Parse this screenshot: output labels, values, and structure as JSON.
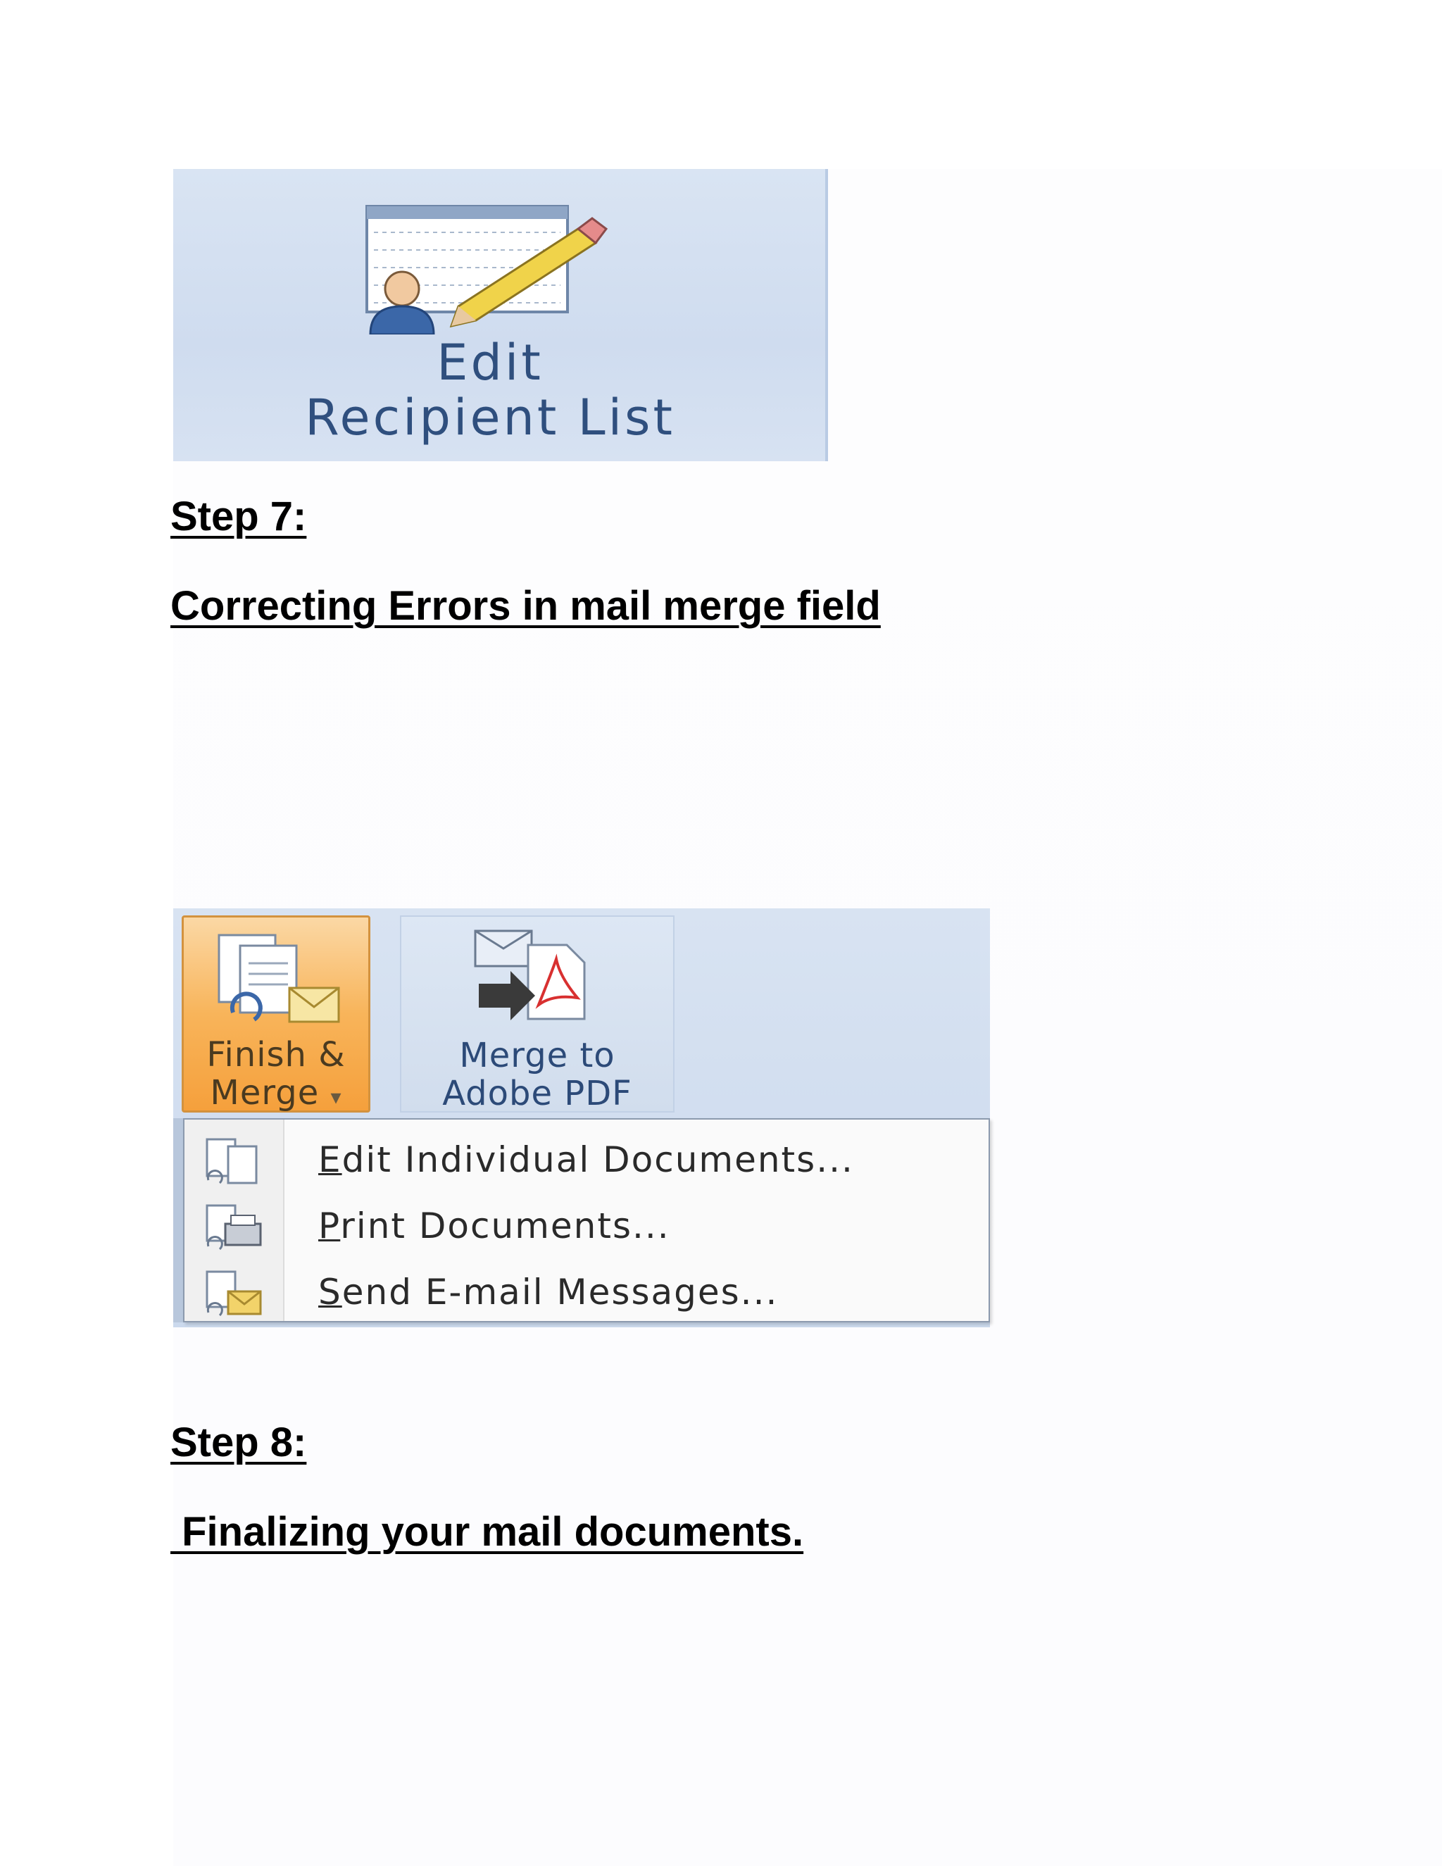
{
  "screenshot1": {
    "label_line1": "Edit",
    "label_line2": "Recipient List",
    "icon": "edit-recipient-list-icon"
  },
  "step7": {
    "heading": "Step 7:",
    "subheading": "Correcting Errors in mail merge field"
  },
  "screenshot2": {
    "finish_merge_line1": "Finish &",
    "finish_merge_line2": "Merge",
    "dropdown_arrow": "▾",
    "merge_pdf_line1": "Merge to",
    "merge_pdf_line2": "Adobe PDF",
    "menu_items": [
      {
        "accel": "E",
        "rest": "dit Individual Documents...",
        "icon": "edit-documents-icon"
      },
      {
        "accel": "P",
        "rest": "rint Documents...",
        "icon": "print-documents-icon"
      },
      {
        "accel": "S",
        "rest": "end E-mail Messages...",
        "icon": "send-email-icon"
      }
    ],
    "colors": {
      "finish_button": "#f8b45a",
      "ribbon": "#cfdcef"
    }
  },
  "step8": {
    "heading": "Step 8:",
    "subheading": " Finalizing your mail documents."
  }
}
